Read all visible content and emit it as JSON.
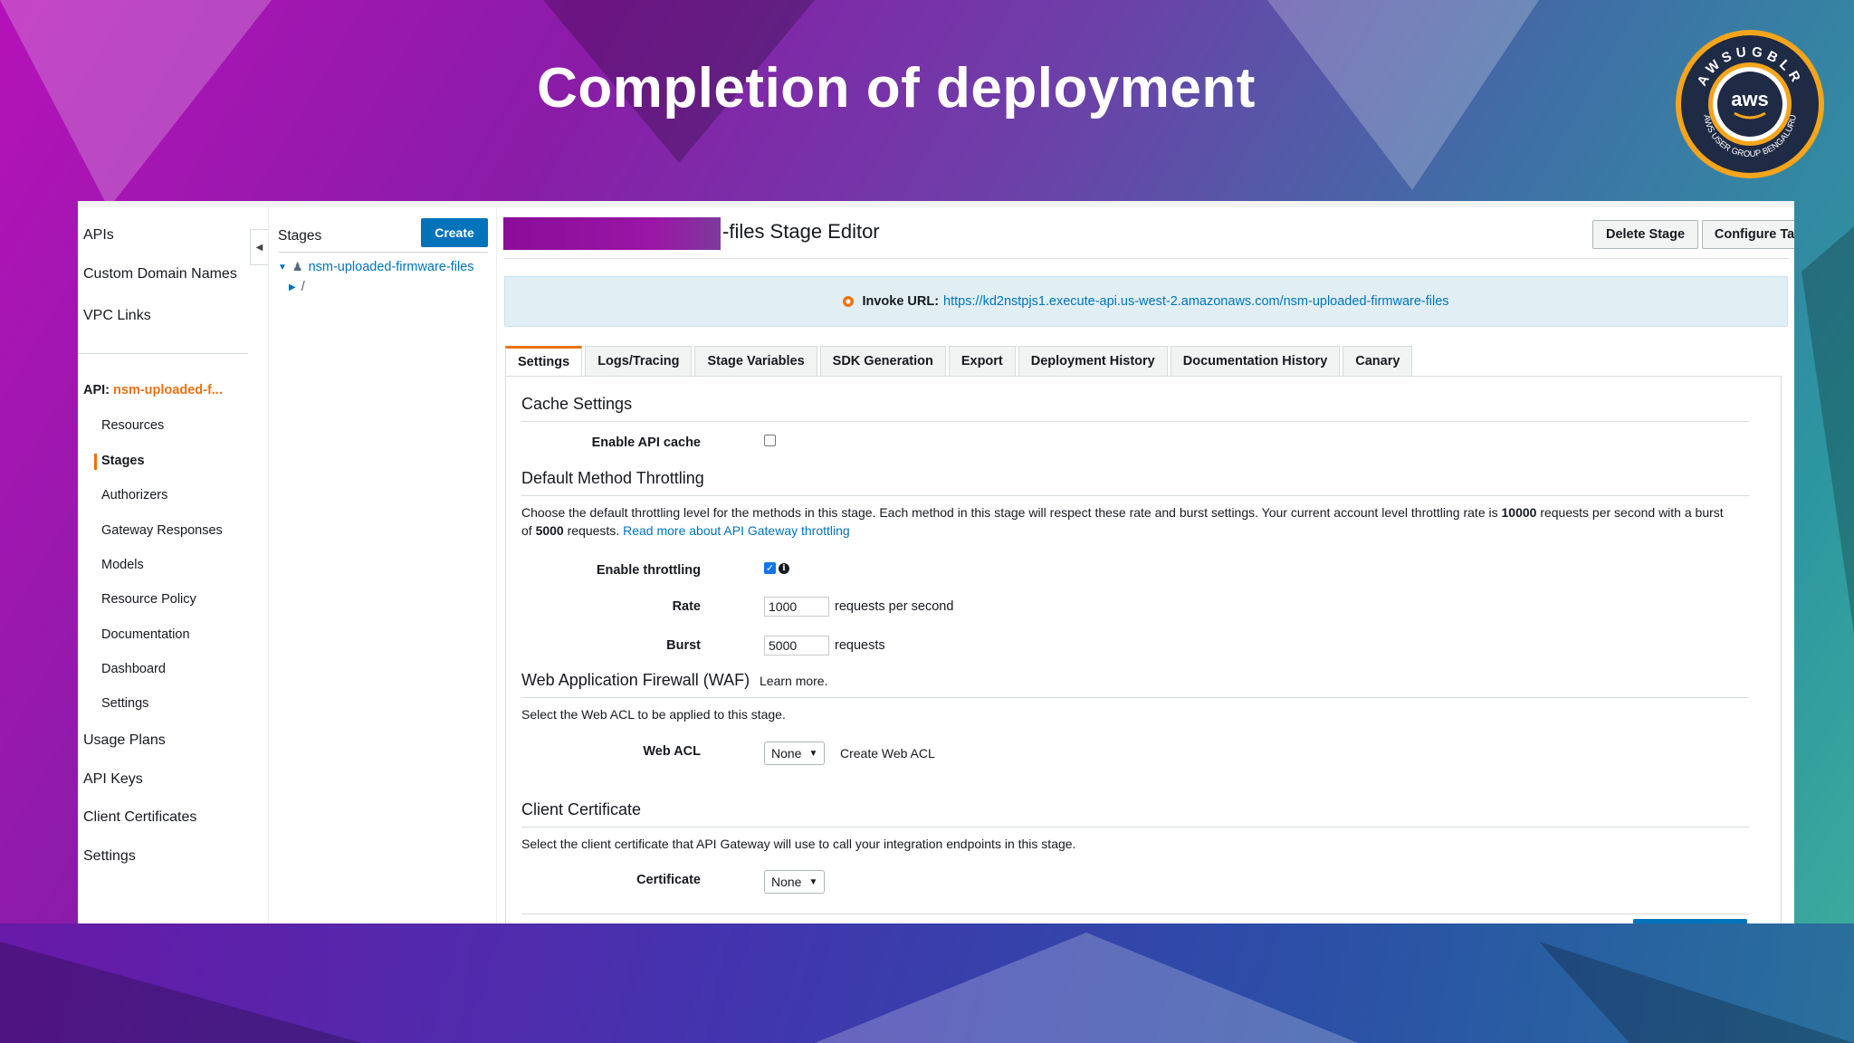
{
  "slide": {
    "title": "Completion of deployment",
    "logo": {
      "icon": "aws-user-group-bengaluru-logo",
      "ring_text": "AWSUGBLR",
      "inner_text": "aws",
      "sub_text": "AWS USER GROUP BENGALURU"
    }
  },
  "left_nav": {
    "top_items": [
      "APIs",
      "Custom Domain Names",
      "VPC Links"
    ],
    "api_prefix": "API:",
    "api_name": "nsm-uploaded-f...",
    "sub_items": [
      "Resources",
      "Stages",
      "Authorizers",
      "Gateway Responses",
      "Models",
      "Resource Policy",
      "Documentation",
      "Dashboard",
      "Settings"
    ],
    "active_item": "Stages",
    "bottom_items": [
      "Usage Plans",
      "API Keys",
      "Client Certificates",
      "Settings"
    ]
  },
  "stages_panel": {
    "title": "Stages",
    "create_label": "Create",
    "tree": {
      "stage_name": "nsm-uploaded-firmware-files",
      "child": "/"
    }
  },
  "editor": {
    "title": "-files Stage Editor",
    "delete_label": "Delete Stage",
    "configure_tags_label": "Configure Tags",
    "invoke_label": "Invoke URL:",
    "invoke_url": "https://kd2nstpjs1.execute-api.us-west-2.amazonaws.com/nsm-uploaded-firmware-files",
    "tabs": [
      "Settings",
      "Logs/Tracing",
      "Stage Variables",
      "SDK Generation",
      "Export",
      "Deployment History",
      "Documentation History",
      "Canary"
    ],
    "active_tab": "Settings"
  },
  "settings": {
    "cache": {
      "title": "Cache Settings",
      "enable_label": "Enable API cache",
      "enabled": false
    },
    "throttling": {
      "title": "Default Method Throttling",
      "desc_1": "Choose the default throttling level for the methods in this stage. Each method in this stage will respect these rate and burst settings. Your current account level throttling rate is ",
      "rate_limit": "10000",
      "desc_2": " requests per second with a burst",
      "desc_3": "of ",
      "burst_limit": "5000",
      "desc_4": " requests. ",
      "read_more": "Read more about API Gateway throttling",
      "enable_label": "Enable throttling",
      "enabled": true,
      "rate_label": "Rate",
      "rate_value": "1000",
      "rate_unit": "requests per second",
      "burst_label": "Burst",
      "burst_value": "5000",
      "burst_unit": "requests"
    },
    "waf": {
      "title": "Web Application Firewall (WAF)",
      "learn_more": "Learn more.",
      "desc": "Select the Web ACL to be applied to this stage.",
      "acl_label": "Web ACL",
      "acl_value": "None",
      "create_link": "Create Web ACL"
    },
    "client_cert": {
      "title": "Client Certificate",
      "desc": "Select the client certificate that API Gateway will use to call your integration endpoints in this stage.",
      "cert_label": "Certificate",
      "cert_value": "None"
    }
  },
  "colors": {
    "accent_orange": "#ec7211",
    "link_blue": "#0073bb",
    "button_blue": "#0073bb"
  }
}
